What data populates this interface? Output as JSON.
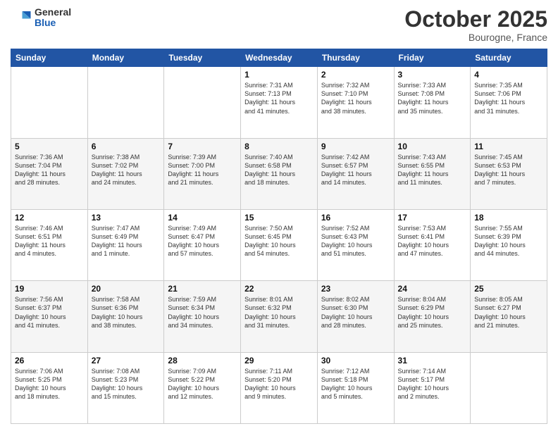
{
  "header": {
    "logo_general": "General",
    "logo_blue": "Blue",
    "month_title": "October 2025",
    "location": "Bourogne, France"
  },
  "days_of_week": [
    "Sunday",
    "Monday",
    "Tuesday",
    "Wednesday",
    "Thursday",
    "Friday",
    "Saturday"
  ],
  "weeks": [
    [
      {
        "day": "",
        "info": ""
      },
      {
        "day": "",
        "info": ""
      },
      {
        "day": "",
        "info": ""
      },
      {
        "day": "1",
        "info": "Sunrise: 7:31 AM\nSunset: 7:13 PM\nDaylight: 11 hours\nand 41 minutes."
      },
      {
        "day": "2",
        "info": "Sunrise: 7:32 AM\nSunset: 7:10 PM\nDaylight: 11 hours\nand 38 minutes."
      },
      {
        "day": "3",
        "info": "Sunrise: 7:33 AM\nSunset: 7:08 PM\nDaylight: 11 hours\nand 35 minutes."
      },
      {
        "day": "4",
        "info": "Sunrise: 7:35 AM\nSunset: 7:06 PM\nDaylight: 11 hours\nand 31 minutes."
      }
    ],
    [
      {
        "day": "5",
        "info": "Sunrise: 7:36 AM\nSunset: 7:04 PM\nDaylight: 11 hours\nand 28 minutes."
      },
      {
        "day": "6",
        "info": "Sunrise: 7:38 AM\nSunset: 7:02 PM\nDaylight: 11 hours\nand 24 minutes."
      },
      {
        "day": "7",
        "info": "Sunrise: 7:39 AM\nSunset: 7:00 PM\nDaylight: 11 hours\nand 21 minutes."
      },
      {
        "day": "8",
        "info": "Sunrise: 7:40 AM\nSunset: 6:58 PM\nDaylight: 11 hours\nand 18 minutes."
      },
      {
        "day": "9",
        "info": "Sunrise: 7:42 AM\nSunset: 6:57 PM\nDaylight: 11 hours\nand 14 minutes."
      },
      {
        "day": "10",
        "info": "Sunrise: 7:43 AM\nSunset: 6:55 PM\nDaylight: 11 hours\nand 11 minutes."
      },
      {
        "day": "11",
        "info": "Sunrise: 7:45 AM\nSunset: 6:53 PM\nDaylight: 11 hours\nand 7 minutes."
      }
    ],
    [
      {
        "day": "12",
        "info": "Sunrise: 7:46 AM\nSunset: 6:51 PM\nDaylight: 11 hours\nand 4 minutes."
      },
      {
        "day": "13",
        "info": "Sunrise: 7:47 AM\nSunset: 6:49 PM\nDaylight: 11 hours\nand 1 minute."
      },
      {
        "day": "14",
        "info": "Sunrise: 7:49 AM\nSunset: 6:47 PM\nDaylight: 10 hours\nand 57 minutes."
      },
      {
        "day": "15",
        "info": "Sunrise: 7:50 AM\nSunset: 6:45 PM\nDaylight: 10 hours\nand 54 minutes."
      },
      {
        "day": "16",
        "info": "Sunrise: 7:52 AM\nSunset: 6:43 PM\nDaylight: 10 hours\nand 51 minutes."
      },
      {
        "day": "17",
        "info": "Sunrise: 7:53 AM\nSunset: 6:41 PM\nDaylight: 10 hours\nand 47 minutes."
      },
      {
        "day": "18",
        "info": "Sunrise: 7:55 AM\nSunset: 6:39 PM\nDaylight: 10 hours\nand 44 minutes."
      }
    ],
    [
      {
        "day": "19",
        "info": "Sunrise: 7:56 AM\nSunset: 6:37 PM\nDaylight: 10 hours\nand 41 minutes."
      },
      {
        "day": "20",
        "info": "Sunrise: 7:58 AM\nSunset: 6:36 PM\nDaylight: 10 hours\nand 38 minutes."
      },
      {
        "day": "21",
        "info": "Sunrise: 7:59 AM\nSunset: 6:34 PM\nDaylight: 10 hours\nand 34 minutes."
      },
      {
        "day": "22",
        "info": "Sunrise: 8:01 AM\nSunset: 6:32 PM\nDaylight: 10 hours\nand 31 minutes."
      },
      {
        "day": "23",
        "info": "Sunrise: 8:02 AM\nSunset: 6:30 PM\nDaylight: 10 hours\nand 28 minutes."
      },
      {
        "day": "24",
        "info": "Sunrise: 8:04 AM\nSunset: 6:29 PM\nDaylight: 10 hours\nand 25 minutes."
      },
      {
        "day": "25",
        "info": "Sunrise: 8:05 AM\nSunset: 6:27 PM\nDaylight: 10 hours\nand 21 minutes."
      }
    ],
    [
      {
        "day": "26",
        "info": "Sunrise: 7:06 AM\nSunset: 5:25 PM\nDaylight: 10 hours\nand 18 minutes."
      },
      {
        "day": "27",
        "info": "Sunrise: 7:08 AM\nSunset: 5:23 PM\nDaylight: 10 hours\nand 15 minutes."
      },
      {
        "day": "28",
        "info": "Sunrise: 7:09 AM\nSunset: 5:22 PM\nDaylight: 10 hours\nand 12 minutes."
      },
      {
        "day": "29",
        "info": "Sunrise: 7:11 AM\nSunset: 5:20 PM\nDaylight: 10 hours\nand 9 minutes."
      },
      {
        "day": "30",
        "info": "Sunrise: 7:12 AM\nSunset: 5:18 PM\nDaylight: 10 hours\nand 5 minutes."
      },
      {
        "day": "31",
        "info": "Sunrise: 7:14 AM\nSunset: 5:17 PM\nDaylight: 10 hours\nand 2 minutes."
      },
      {
        "day": "",
        "info": ""
      }
    ]
  ]
}
